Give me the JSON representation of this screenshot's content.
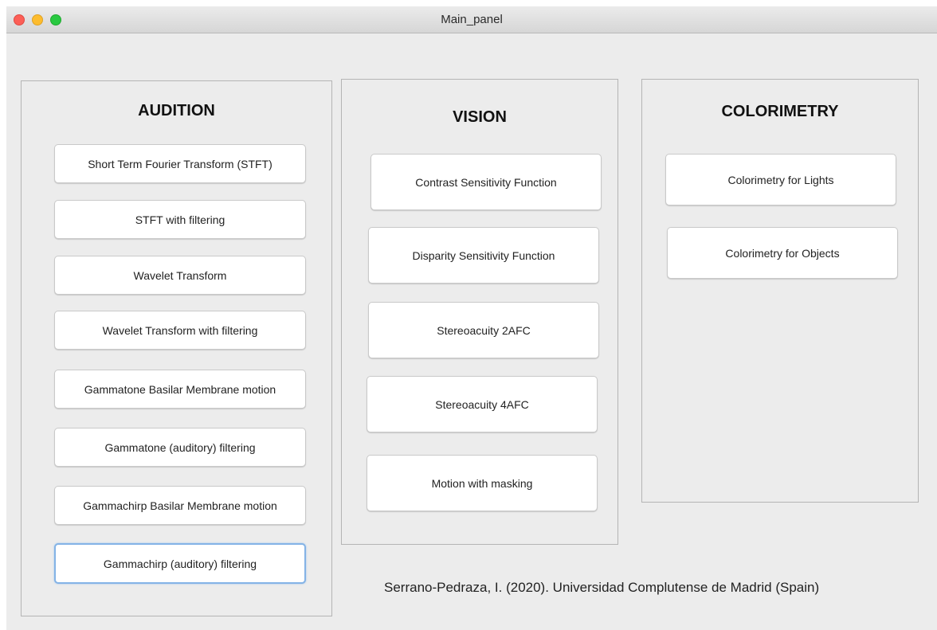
{
  "window": {
    "title": "Main_panel"
  },
  "audition": {
    "title": "AUDITION",
    "buttons": [
      "Short Term Fourier Transform (STFT)",
      "STFT with filtering",
      "Wavelet Transform",
      "Wavelet Transform with filtering",
      "Gammatone Basilar Membrane motion",
      "Gammatone (auditory) filtering",
      "Gammachirp Basilar Membrane motion",
      "Gammachirp (auditory) filtering"
    ]
  },
  "vision": {
    "title": "VISION",
    "buttons": [
      "Contrast Sensitivity Function",
      "Disparity Sensitivity Function",
      "Stereoacuity 2AFC",
      "Stereoacuity 4AFC",
      "Motion with masking"
    ]
  },
  "colorimetry": {
    "title": "COLORIMETRY",
    "buttons": [
      "Colorimetry for Lights",
      "Colorimetry for Objects"
    ]
  },
  "footer": {
    "credits": "Serrano-Pedraza, I. (2020). Universidad Complutense de Madrid (Spain)"
  }
}
